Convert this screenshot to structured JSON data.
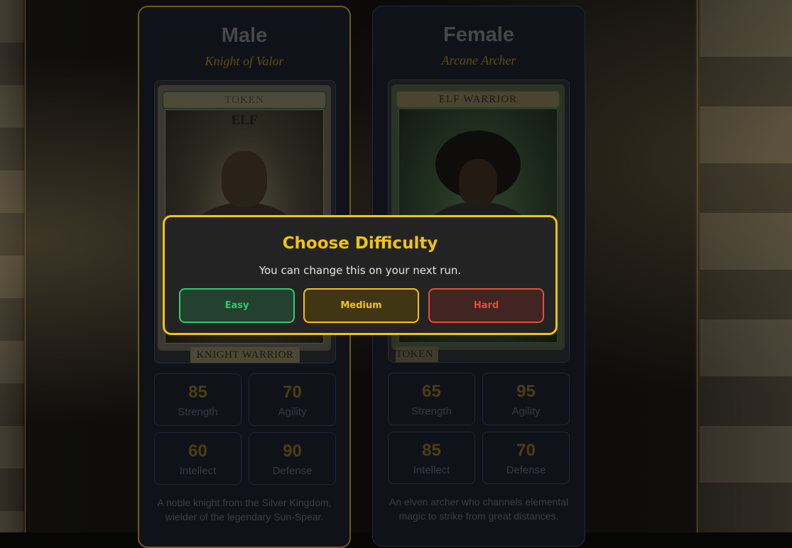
{
  "characters": [
    {
      "name": "Male",
      "class": "Knight of Valor",
      "token": {
        "banner": "TOKEN",
        "subtitle": "ELF",
        "bottom": "KNIGHT WARRIOR"
      },
      "stats": [
        {
          "value": "85",
          "label": "Strength"
        },
        {
          "value": "70",
          "label": "Agility"
        },
        {
          "value": "60",
          "label": "Intellect"
        },
        {
          "value": "90",
          "label": "Defense"
        }
      ],
      "description": "A noble knight from the Silver Kingdom, wielder of the legendary Sun-Spear."
    },
    {
      "name": "Female",
      "class": "Arcane Archer",
      "token": {
        "banner": "ELF WARRIOR",
        "bottom": "TOKEN"
      },
      "stats": [
        {
          "value": "65",
          "label": "Strength"
        },
        {
          "value": "95",
          "label": "Agility"
        },
        {
          "value": "85",
          "label": "Intellect"
        },
        {
          "value": "70",
          "label": "Defense"
        }
      ],
      "description": "An elven archer who channels elemental magic to strike from great distances."
    }
  ],
  "modal": {
    "title": "Choose Difficulty",
    "subtitle": "You can change this on your next run.",
    "buttons": {
      "easy": "Easy",
      "medium": "Medium",
      "hard": "Hard"
    }
  },
  "colors": {
    "accent": "#f2c40f",
    "easy": "#2ecc71",
    "medium": "#f1c40f",
    "hard": "#e74c3c"
  }
}
